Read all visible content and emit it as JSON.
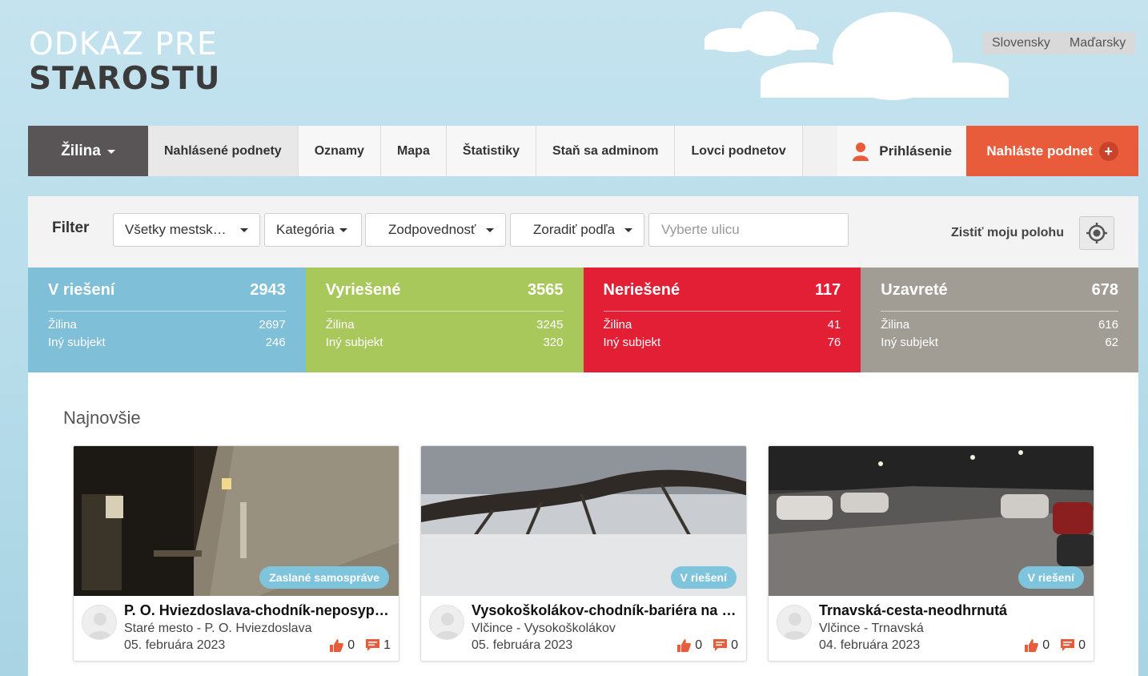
{
  "logo": {
    "line1": "ODKAZ PRE",
    "line2": "STAROSTU"
  },
  "languages": [
    "Slovensky",
    "Maďarsky"
  ],
  "nav": {
    "city": "Žilina",
    "items": [
      "Nahlásené podnety",
      "Oznamy",
      "Mapa",
      "Štatistiky",
      "Staň sa adminom",
      "Lovci podnetov"
    ],
    "login": "Prihlásenie",
    "report": "Nahláste podnet",
    "report_plus": "+"
  },
  "filter": {
    "label": "Filter",
    "district": "Všetky mestsk…",
    "category": "Kategória",
    "responsibility": "Zodpovednosť",
    "sort": "Zoradiť podľa",
    "street_placeholder": "Vyberte ulicu",
    "locate_label": "Zistiť moju polohu"
  },
  "stats": [
    {
      "name": "V riešení",
      "total": "2943",
      "color": "#7fbfd7",
      "rows": [
        {
          "label": "Žilina",
          "value": "2697"
        },
        {
          "label": "Iný subjekt",
          "value": "246"
        }
      ]
    },
    {
      "name": "Vyriešené",
      "total": "3565",
      "color": "#a9c85c",
      "rows": [
        {
          "label": "Žilina",
          "value": "3245"
        },
        {
          "label": "Iný subjekt",
          "value": "320"
        }
      ]
    },
    {
      "name": "Neriešené",
      "total": "117",
      "color": "#e21f34",
      "rows": [
        {
          "label": "Žilina",
          "value": "41"
        },
        {
          "label": "Iný subjekt",
          "value": "76"
        }
      ]
    },
    {
      "name": "Uzavreté",
      "total": "678",
      "color": "#a29d94",
      "rows": [
        {
          "label": "Žilina",
          "value": "616"
        },
        {
          "label": "Iný subjekt",
          "value": "62"
        }
      ]
    }
  ],
  "newest": {
    "heading": "Najnovšie",
    "cards": [
      {
        "title": "P. O. Hviezdoslava-chodník-neposyp…",
        "location": "Staré mesto - P. O. Hviezdoslava",
        "date": "05. februára 2023",
        "badge": "Zaslané samospráve",
        "likes": "0",
        "comments": "1"
      },
      {
        "title": "Vysokoškolákov-chodník-bariéra na …",
        "location": "Vlčince - Vysokoškolákov",
        "date": "05. februára 2023",
        "badge": "V riešení",
        "likes": "0",
        "comments": "0"
      },
      {
        "title": "Trnavská-cesta-neodhrnutá",
        "location": "Vlčince - Trnavská",
        "date": "04. februára 2023",
        "badge": "V riešení",
        "likes": "0",
        "comments": "0"
      }
    ]
  },
  "colors": {
    "accent": "#e85c3b",
    "nav_city_bg": "#595556"
  }
}
